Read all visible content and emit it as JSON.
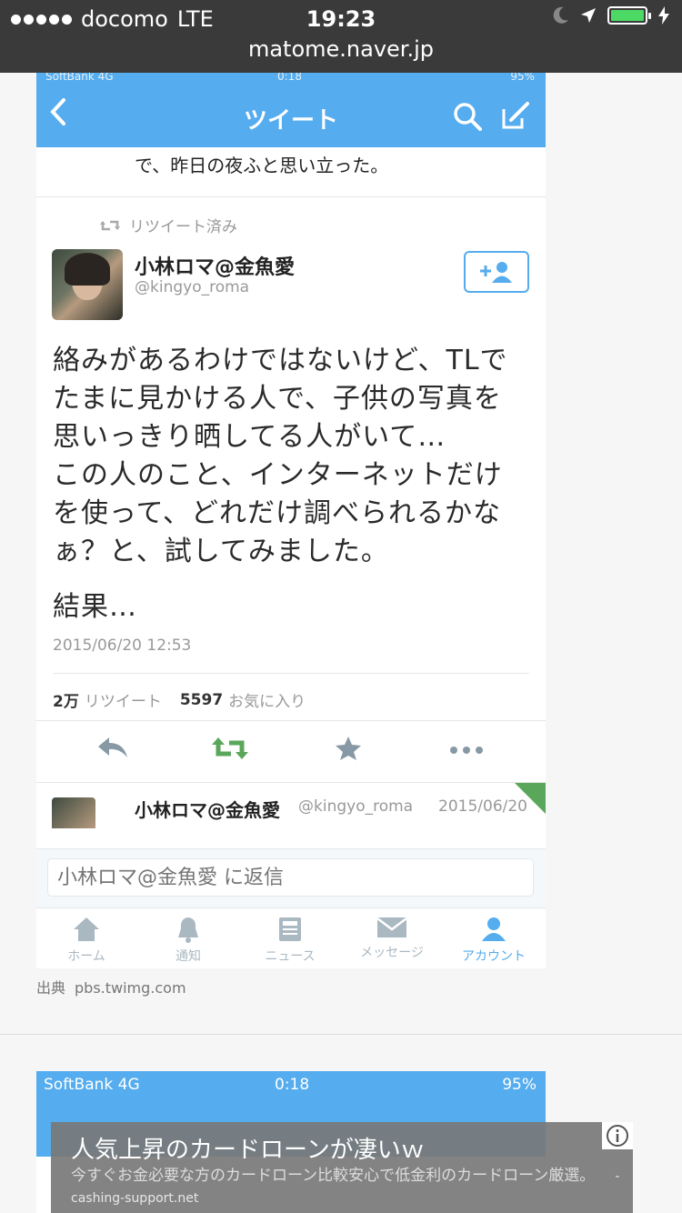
{
  "safari": {
    "carrier": "docomo",
    "network": "LTE",
    "time": "19:23",
    "url": "matome.naver.jp"
  },
  "tweet": {
    "status_left": "SoftBank 4G",
    "status_time": "0:18",
    "status_right": "95%",
    "header_title": "ツイート",
    "prev_tail": "で、昨日の夜ふと思い立った。",
    "retweeted_label": "リツイート済み",
    "author_name": "小林ロマ@金魚愛",
    "author_handle": "@kingyo_roma",
    "body": "絡みがあるわけではないけど、TLで\nたまに見かける人で、子供の写真を\n思いっきり晒してる人がいて…\nこの人のこと、インターネットだけ\nを使って、どれだけ調べられるかな\nぁ？と、試してみました。",
    "result": "結果…",
    "timestamp": "2015/06/20 12:53",
    "retweet_count": "2万",
    "retweet_label": "リツイート",
    "favorite_count": "5597",
    "favorite_label": "お気に入り",
    "reply_name": "小林ロマ@金魚愛",
    "reply_handle": "@kingyo_roma",
    "reply_date": "2015/06/20",
    "compose_placeholder": "小林ロマ@金魚愛 に返信",
    "tabs": [
      "ホーム",
      "通知",
      "ニュース",
      "メッセージ",
      "アカウント"
    ]
  },
  "source": {
    "label": "出典",
    "domain": "pbs.twimg.com"
  },
  "tweet2": {
    "status_left": "SoftBank 4G",
    "status_time": "0:18",
    "status_right": "95%"
  },
  "ad": {
    "title": "人気上昇のカードローンが凄いｗ",
    "description": "今すぐお金必要な方のカードローン比較安心で低金利のカードローン厳選。",
    "source": "- cashing-support.net"
  },
  "colors": {
    "twitter_blue": "#55acee",
    "retweet_green": "#5aa65a",
    "safari_bar": "#3a3a3a"
  }
}
